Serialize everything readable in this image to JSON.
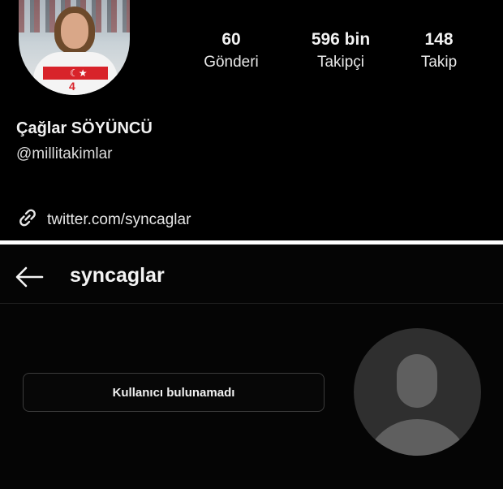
{
  "profile": {
    "avatar_icon": "profile-photo",
    "stats": [
      {
        "value": "60",
        "label": "Gönderi"
      },
      {
        "value": "596 bin",
        "label": "Takipçi"
      },
      {
        "value": "148",
        "label": "Takip"
      }
    ],
    "name": "Çağlar SÖYÜNCÜ",
    "handle": "@millitakimlar",
    "link_icon": "link-icon",
    "link_text": "twitter.com/syncaglar"
  },
  "search_result": {
    "back_icon": "arrow-left-icon",
    "username": "syncaglar",
    "not_found_label": "Kullanıcı bulunamadı",
    "default_avatar_icon": "default-user-avatar-icon"
  }
}
